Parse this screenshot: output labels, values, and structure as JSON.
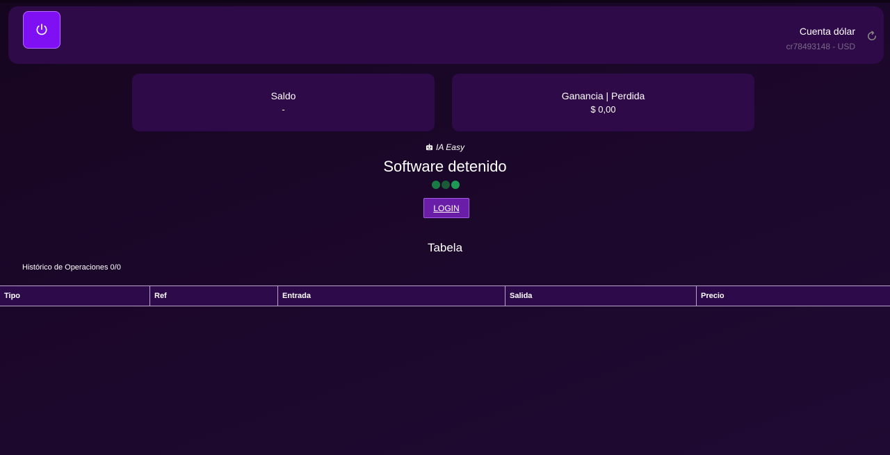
{
  "header": {
    "account_name": "Cuenta dólar",
    "account_id": "cr78493148 - USD",
    "power_icon": "power-icon",
    "refresh_icon": "refresh-icon"
  },
  "cards": {
    "saldo": {
      "label": "Saldo",
      "value": "-"
    },
    "ganancia": {
      "label": "Ganancia | Perdida",
      "value": "$ 0,00"
    }
  },
  "bot": {
    "icon": "robot-icon",
    "name": "IA Easy",
    "status": "Software detenido",
    "dots": [
      "#1a7a44",
      "#1a5a38",
      "#1f9a55"
    ]
  },
  "login": {
    "label": "LOGIN"
  },
  "table": {
    "title": "Tabela",
    "history": "Histórico de Operaciones 0/0",
    "columns": [
      "Tipo",
      "Ref",
      "Entrada",
      "Salida",
      "Precio"
    ],
    "rows": []
  },
  "colors": {
    "accent": "#7f10f4",
    "panel": "#2e0a48",
    "background": "#1b0729"
  }
}
